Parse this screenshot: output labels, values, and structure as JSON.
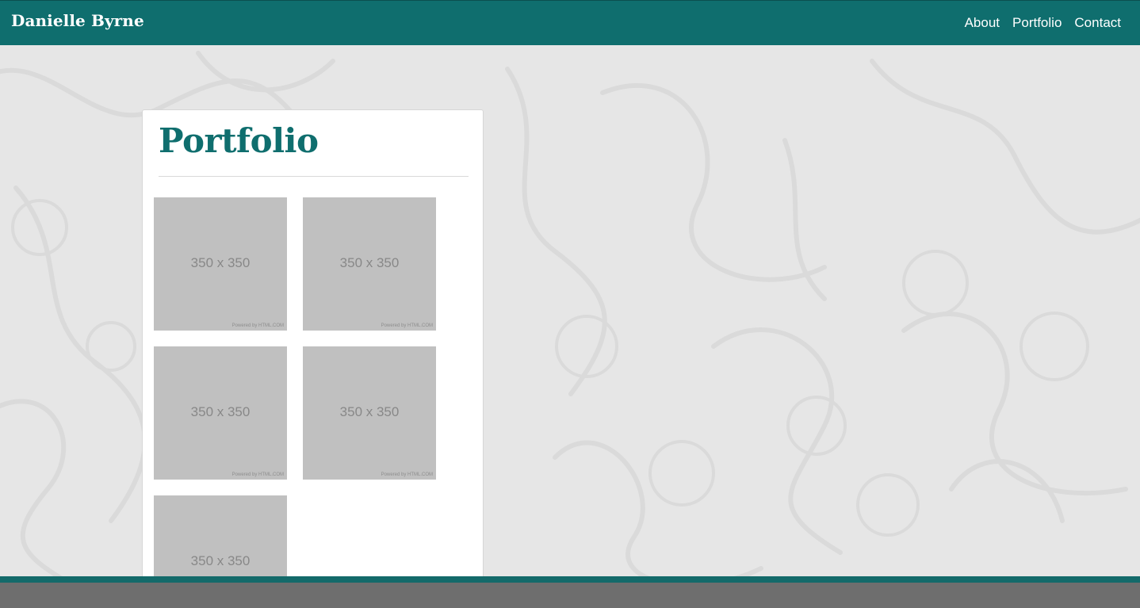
{
  "header": {
    "brand": "Danielle Byrne",
    "nav": [
      {
        "label": "About"
      },
      {
        "label": "Portfolio"
      },
      {
        "label": "Contact"
      }
    ]
  },
  "main": {
    "title": "Portfolio",
    "thumbnails": [
      {
        "label": "350 x 350",
        "credit": "Powered by HTML.COM"
      },
      {
        "label": "350 x 350",
        "credit": "Powered by HTML.COM"
      },
      {
        "label": "350 x 350",
        "credit": "Powered by HTML.COM"
      },
      {
        "label": "350 x 350",
        "credit": "Powered by HTML.COM"
      },
      {
        "label": "350 x 350",
        "credit": ""
      }
    ]
  },
  "colors": {
    "brand": "#0f6e6e",
    "page_background": "#e6e6e6",
    "placeholder": "#c0c0c0",
    "footer": "#6e6e6e"
  }
}
